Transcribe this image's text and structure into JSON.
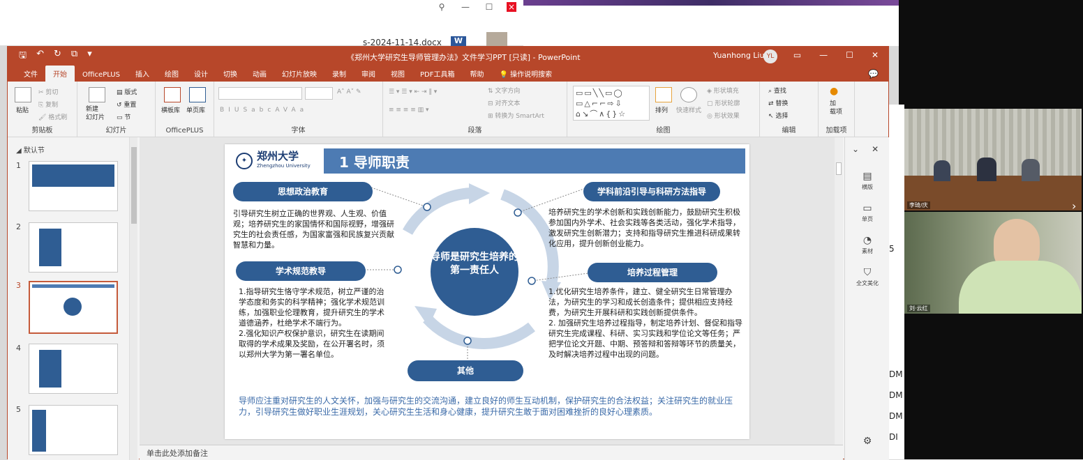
{
  "background_window": {
    "file_name": "s-2024-11-14.docx",
    "word_badge": "W"
  },
  "ppt": {
    "title": "《郑州大学研究生导师管理办法》文件学习PPT [只读] - PowerPoint",
    "user_name": "Yuanhong Liu",
    "user_initials": "YL",
    "tabs": [
      "文件",
      "开始",
      "OfficePLUS",
      "插入",
      "绘图",
      "设计",
      "切换",
      "动画",
      "幻灯片放映",
      "录制",
      "审阅",
      "视图",
      "PDF工具箱",
      "帮助",
      "操作说明搜索"
    ],
    "active_tab": "开始",
    "ribbon": {
      "clipboard": {
        "label": "剪贴板",
        "paste": "粘贴",
        "cut": "剪切",
        "copy": "复制",
        "format_painter": "格式刷"
      },
      "slides": {
        "label": "幻灯片",
        "new_slide": "新建\n幻灯片",
        "layout": "版式",
        "reset": "重置",
        "section": "节"
      },
      "officeplus": {
        "label": "OfficePLUS",
        "layout_lib": "横板库",
        "page_lib": "单页库"
      },
      "font": {
        "label": "字体",
        "buttons": [
          "B",
          "I",
          "U",
          "S",
          "abc",
          "AV",
          "Aa"
        ]
      },
      "paragraph": {
        "label": "段落",
        "text_direction": "文字方向",
        "align_text": "对齐文本",
        "smartart": "转换为 SmartArt"
      },
      "drawing": {
        "label": "绘图",
        "arrange": "排列",
        "quick_styles": "快速样式",
        "shape_fill": "形状填充",
        "shape_outline": "形状轮廓",
        "shape_effects": "形状效果"
      },
      "editing": {
        "label": "编辑",
        "find": "查找",
        "replace": "替换",
        "select": "选择"
      },
      "addins": {
        "label": "加载项",
        "addins_btn": "加\n载项"
      }
    },
    "section_name": "默认节",
    "slide_numbers": [
      "1",
      "2",
      "3",
      "4",
      "5"
    ],
    "selected_slide": "3",
    "notes_placeholder": "单击此处添加备注",
    "right_panel": [
      "横版",
      "单页",
      "素材",
      "全文美化"
    ]
  },
  "slide": {
    "university": "郑州大学",
    "university_en": "Zhengzhou University",
    "title": "1 导师职责",
    "center": "导师是研究生培养的第一责任人",
    "sections": {
      "political": {
        "heading": "思想政治教育",
        "body": "引导研究生树立正确的世界观、人生观、价值观；培养研究生的家国情怀和国际视野，增强研究生的社会责任感，为国家富强和民族复兴贡献智慧和力量。"
      },
      "research": {
        "heading": "学科前沿引导与科研方法指导",
        "body": "培养研究生的学术创新和实践创新能力，鼓励研究生积极参加国内外学术、社会实践等各类活动，强化学术指导，激发研究生创新潜力；支持和指导研究生推进科研成果转化应用，提升创新创业能力。"
      },
      "academic": {
        "heading": "学术规范教导",
        "body": "1.指导研究生恪守学术规范，树立严谨的治学态度和务实的科学精神；强化学术规范训练，加强职业伦理教育，提升研究生的学术道德涵养，杜绝学术不端行为。\n2.强化知识产权保护意识，研究生在读期间取得的学术成果及奖励，在公开署名时，须以郑州大学为第一署名单位。"
      },
      "training": {
        "heading": "培养过程管理",
        "body": "1.优化研究生培养条件，建立、健全研究生日常管理办法，为研究生的学习和成长创造条件；提供相应支持经费，为研究生开展科研和实践创新提供条件。\n2. 加强研究生培养过程指导，制定培养计划、督促和指导研究生完成课程、科研、实习实践和学位论文等任务；严把学位论文开题、中期、预答辩和答辩等环节的质量关，及时解决培养过程中出现的问题。"
      },
      "other": {
        "heading": "其他"
      }
    },
    "footer": "导师应注重对研究生的人文关怀，加强与研究生的交流沟通，建立良好的师生互动机制，保护研究生的合法权益；关注研究生的就业压力，引导研究生做好职业生涯规划，关心研究生生活和身心健康，提升研究生敢于面对困难挫折的良好心理素质。"
  },
  "video": {
    "tile1_name": "李琦/庆",
    "tile2_name": "刘·云红"
  },
  "colors": {
    "ppt_accent": "#b7472a",
    "slide_blue": "#2f5d93",
    "footer_blue": "#3a6aa8"
  }
}
